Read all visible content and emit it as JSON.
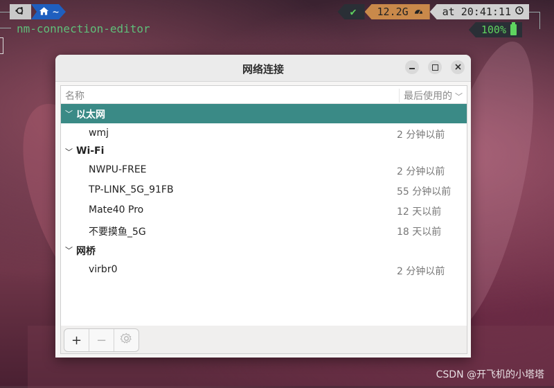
{
  "terminal": {
    "home_segment": "~",
    "check": "✔",
    "memory": "12.2G",
    "time": "at 20:41:11",
    "command": "nm-connection-editor",
    "battery": "100%"
  },
  "window": {
    "title": "网络连接"
  },
  "list": {
    "header_name": "名称",
    "header_used": "最后使用的",
    "groups": [
      {
        "name": "以太网",
        "items": [
          {
            "name": "wmj",
            "used": "2 分钟以前"
          }
        ]
      },
      {
        "name": "Wi-Fi",
        "items": [
          {
            "name": "NWPU-FREE",
            "used": "2 分钟以前"
          },
          {
            "name": "TP-LINK_5G_91FB",
            "used": "55 分钟以前"
          },
          {
            "name": "Mate40 Pro",
            "used": "12 天以前"
          },
          {
            "name": "不要摸鱼_5G",
            "used": "18 天以前"
          }
        ]
      },
      {
        "name": "网桥",
        "items": [
          {
            "name": "virbr0",
            "used": "2 分钟以前"
          }
        ]
      }
    ]
  },
  "toolbar": {
    "add": "+",
    "remove": "−"
  },
  "watermark": "CSDN @开飞机的小塔塔"
}
